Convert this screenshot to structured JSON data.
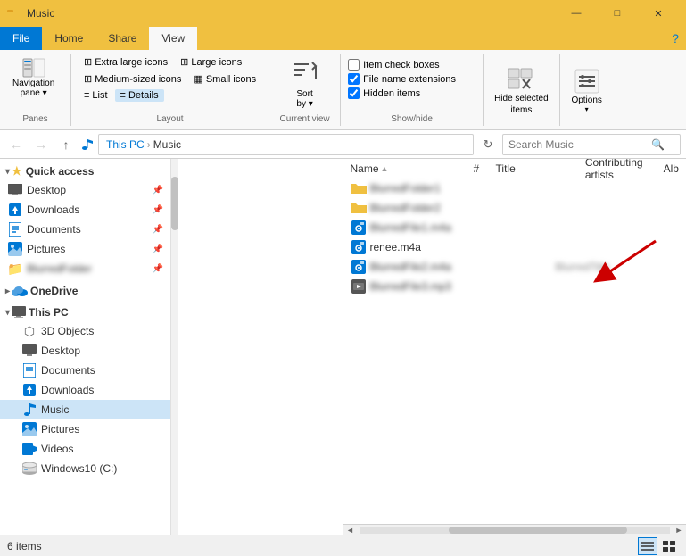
{
  "titleBar": {
    "title": "Music",
    "minimizeLabel": "—",
    "maximizeLabel": "□",
    "closeLabel": "✕"
  },
  "ribbon": {
    "tabs": [
      "File",
      "Home",
      "Share",
      "View"
    ],
    "activeTab": "View",
    "groups": {
      "panes": {
        "label": "Panes",
        "button": "Navigation\npane ▾"
      },
      "layout": {
        "label": "Layout",
        "options": [
          "Extra large icons",
          "Large icons",
          "Medium-sized icons",
          "Small icons",
          "List",
          "Details"
        ]
      },
      "currentView": {
        "label": "Current view",
        "sortBy": "Sort\nby ▾"
      },
      "showHide": {
        "label": "Show/hide",
        "itemCheckBoxes": "Item check boxes",
        "fileNameExtensions": "File name extensions",
        "hiddenItems": "Hidden items",
        "fileNameExtChecked": true,
        "hiddenItemsChecked": true,
        "itemCheckBoxesChecked": false
      },
      "hideSelected": {
        "label": "Hide selected\nitems"
      },
      "options": {
        "label": "Options"
      }
    }
  },
  "addressBar": {
    "path": "This PC > Music",
    "thisPC": "This PC",
    "music": "Music",
    "searchPlaceholder": "Search Music",
    "refreshTooltip": "Refresh"
  },
  "sidebar": {
    "quickAccess": {
      "label": "Quick access",
      "items": [
        {
          "name": "Desktop",
          "pinned": true,
          "type": "desktop"
        },
        {
          "name": "Downloads",
          "pinned": true,
          "type": "downloads"
        },
        {
          "name": "Documents",
          "pinned": true,
          "type": "documents"
        },
        {
          "name": "Pictures",
          "pinned": true,
          "type": "pictures"
        },
        {
          "name": "BlurredItem",
          "pinned": true,
          "type": "folder",
          "blurred": true
        }
      ]
    },
    "oneDrive": {
      "label": "OneDrive"
    },
    "thisPC": {
      "label": "This PC",
      "items": [
        {
          "name": "3D Objects",
          "type": "3d"
        },
        {
          "name": "Desktop",
          "type": "desktop"
        },
        {
          "name": "Documents",
          "type": "documents"
        },
        {
          "name": "Downloads",
          "type": "downloads"
        },
        {
          "name": "Music",
          "type": "music",
          "active": true
        },
        {
          "name": "Pictures",
          "type": "pictures"
        },
        {
          "name": "Videos",
          "type": "videos"
        },
        {
          "name": "Windows10 (C:)",
          "type": "drive"
        }
      ]
    }
  },
  "fileList": {
    "columns": {
      "name": "Name",
      "hash": "#",
      "title": "Title",
      "contributingArtists": "Contributing artists",
      "album": "Alb"
    },
    "files": [
      {
        "name": "BlurFolder1",
        "type": "folder",
        "blurred": true
      },
      {
        "name": "BlurFolder2",
        "type": "folder",
        "blurred": true
      },
      {
        "name": "BlurFile1",
        "type": "media",
        "blurred": true
      },
      {
        "name": "renee.m4a",
        "type": "media",
        "blurred": false,
        "selected": false
      },
      {
        "name": "BlurFile2",
        "type": "media",
        "blurred": true,
        "titleBlurred": true
      },
      {
        "name": "BlurFile3",
        "type": "media2",
        "blurred": true
      }
    ]
  },
  "statusBar": {
    "itemCount": "6 items",
    "viewButtons": [
      "details",
      "large-icons"
    ]
  }
}
